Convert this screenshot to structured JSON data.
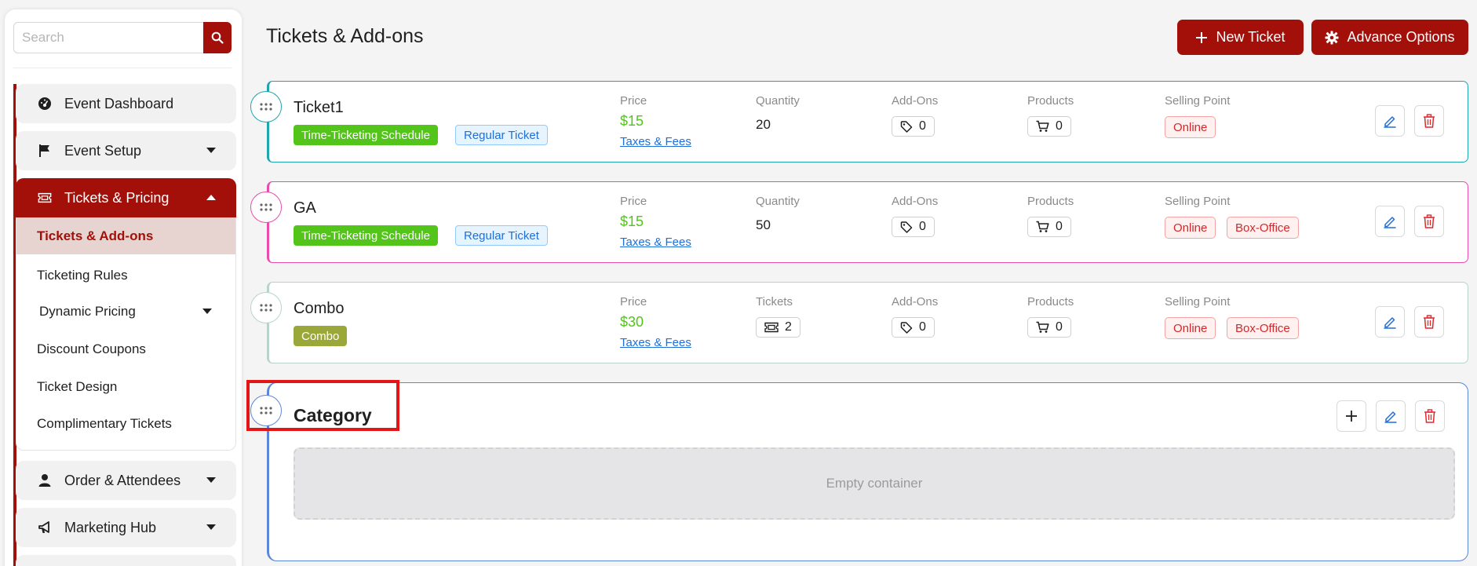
{
  "sidebar": {
    "search_placeholder": "Search",
    "items": {
      "event_dashboard": "Event Dashboard",
      "event_setup": "Event Setup",
      "tickets_pricing": "Tickets & Pricing",
      "order_attendees": "Order & Attendees",
      "marketing_hub": "Marketing Hub"
    },
    "submenu": {
      "tickets_addons": "Tickets & Add-ons",
      "ticketing_rules": "Ticketing Rules",
      "dynamic_pricing": "Dynamic Pricing",
      "discount_coupons": "Discount Coupons",
      "ticket_design": "Ticket Design",
      "complimentary_tickets": "Complimentary Tickets"
    }
  },
  "header": {
    "title": "Tickets & Add-ons",
    "new_ticket": "New Ticket",
    "advance_options": "Advance Options"
  },
  "labels": {
    "price": "Price",
    "quantity": "Quantity",
    "tickets": "Tickets",
    "addons": "Add-Ons",
    "products": "Products",
    "selling_point": "Selling Point",
    "taxes_fees": "Taxes & Fees"
  },
  "tickets": [
    {
      "name": "Ticket1",
      "tags": [
        "Time-Ticketing Schedule",
        "Regular Ticket"
      ],
      "price": "$15",
      "quantity": "20",
      "addons": "0",
      "products": "0",
      "selling_points": [
        "Online"
      ]
    },
    {
      "name": "GA",
      "tags": [
        "Time-Ticketing Schedule",
        "Regular Ticket"
      ],
      "price": "$15",
      "quantity": "50",
      "addons": "0",
      "products": "0",
      "selling_points": [
        "Online",
        "Box-Office"
      ]
    },
    {
      "name": "Combo",
      "tags": [
        "Combo"
      ],
      "price": "$30",
      "tickets_count": "2",
      "addons": "0",
      "products": "0",
      "selling_points": [
        "Online",
        "Box-Office"
      ]
    }
  ],
  "category": {
    "title": "Category",
    "empty_text": "Empty container"
  },
  "colors": {
    "brand": "#a3100a",
    "ticket1_border": "#1fa5ae",
    "ga_border": "#e94cab",
    "combo_border": "#b8d3c8",
    "category_border": "#5b86d9",
    "schedule_tag": "#52c41a",
    "combo_tag": "#9aa83a",
    "highlight": "#e31515"
  }
}
